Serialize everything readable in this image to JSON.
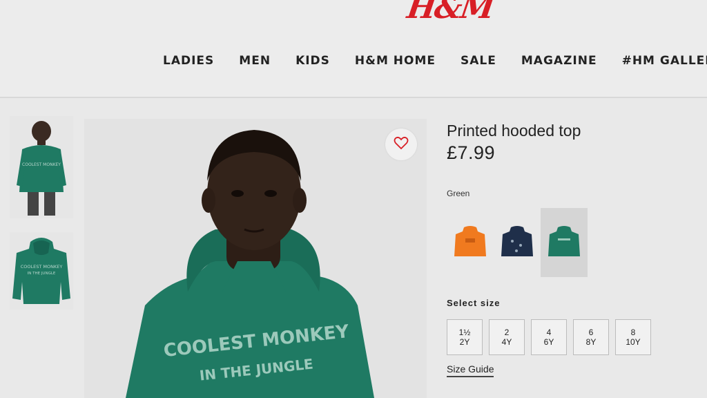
{
  "brand": {
    "logo": "H&M",
    "color": "#d81f26"
  },
  "nav": {
    "items": [
      "LADIES",
      "MEN",
      "KIDS",
      "H&M HOME",
      "SALE",
      "MAGAZINE",
      "#HM GALLERY"
    ]
  },
  "product": {
    "name": "Printed hooded top",
    "price": "£7.99",
    "color_label": "Green",
    "hoodie_print": [
      "COOLEST MONKEY",
      "IN THE JUNGLE"
    ],
    "swatches": [
      {
        "color": "orange",
        "hex": "#f07a1f",
        "selected": false
      },
      {
        "color": "navy",
        "hex": "#1f2f4a",
        "selected": false
      },
      {
        "color": "green",
        "hex": "#1f7a63",
        "selected": true
      }
    ],
    "size_label": "Select size",
    "sizes": [
      {
        "top": "1½",
        "bottom": "2Y"
      },
      {
        "top": "2",
        "bottom": "4Y"
      },
      {
        "top": "4",
        "bottom": "6Y"
      },
      {
        "top": "6",
        "bottom": "8Y"
      },
      {
        "top": "8",
        "bottom": "10Y"
      }
    ],
    "size_guide": "Size Guide"
  },
  "icons": {
    "favorite": "heart-icon"
  },
  "colors": {
    "background": "#e9e9e9",
    "hoodie": "#1f7a63",
    "heart": "#d81f26"
  }
}
